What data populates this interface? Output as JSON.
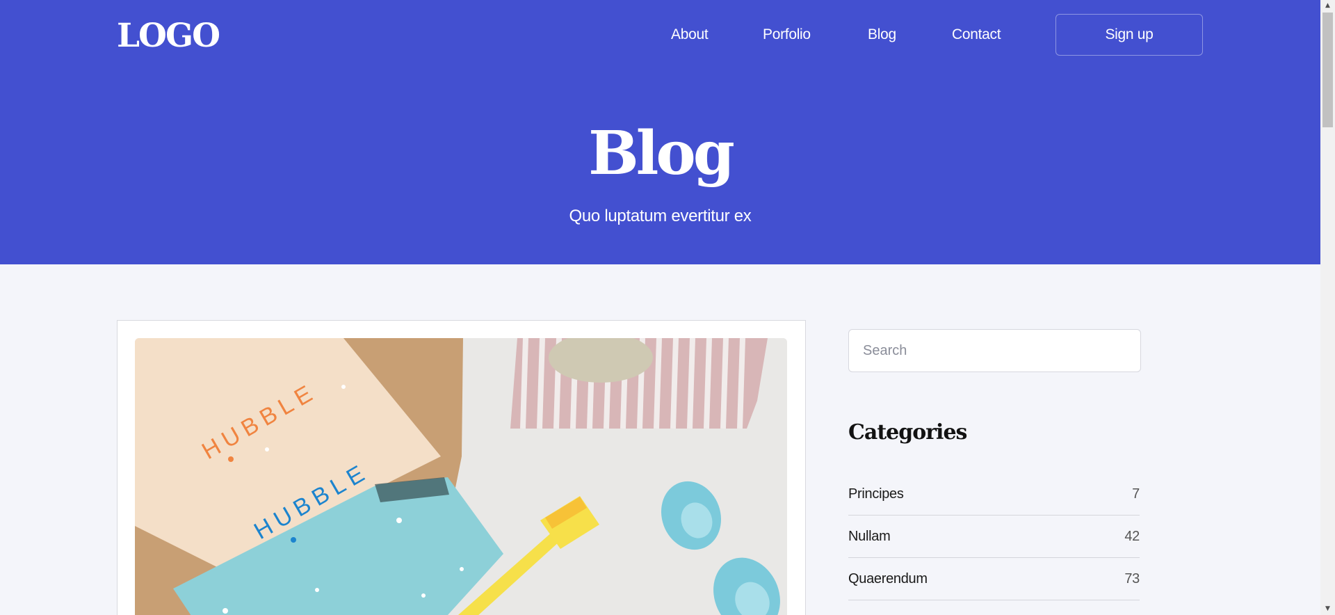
{
  "header": {
    "logo": "LOGO",
    "nav": [
      "About",
      "Porfolio",
      "Blog",
      "Contact"
    ],
    "signup_label": "Sign up"
  },
  "hero": {
    "title": "Blog",
    "subtitle": "Quo luptatum evertitur ex"
  },
  "post": {
    "image_text_top": "HUBBLE",
    "image_text_bottom": "HUBBLE"
  },
  "sidebar": {
    "search_placeholder": "Search",
    "categories_title": "Categories",
    "categories": [
      {
        "name": "Principes",
        "count": "7"
      },
      {
        "name": "Nullam",
        "count": "42"
      },
      {
        "name": "Quaerendum",
        "count": "73"
      }
    ]
  },
  "colors": {
    "hero_bg": "#4350d0",
    "page_bg": "#f4f5fa",
    "text_dark": "#121212"
  },
  "icons": {
    "scroll_up": "triangle-up-icon",
    "scroll_down": "triangle-down-icon"
  }
}
